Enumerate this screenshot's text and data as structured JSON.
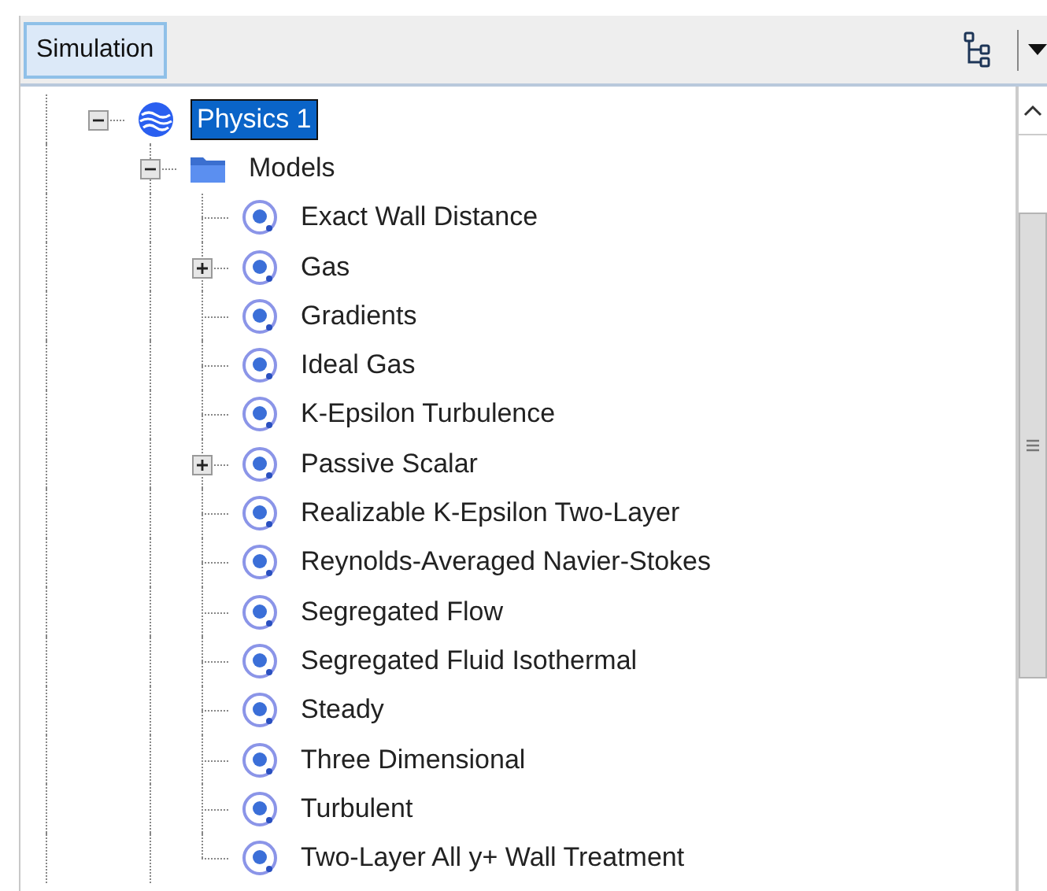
{
  "toolbar": {
    "tab": {
      "label": "Simulation",
      "selected": true
    }
  },
  "tree": [
    {
      "label": "Physics 1",
      "kind": "physics",
      "selected": true,
      "expanded": true,
      "children": [
        {
          "label": "Models",
          "kind": "folder",
          "selected": false,
          "expanded": true,
          "children": [
            {
              "label": "Exact Wall Distance",
              "kind": "model",
              "selected": false
            },
            {
              "label": "Gas",
              "kind": "model",
              "selected": false,
              "expanded": false
            },
            {
              "label": "Gradients",
              "kind": "model",
              "selected": false
            },
            {
              "label": "Ideal Gas",
              "kind": "model",
              "selected": false
            },
            {
              "label": "K-Epsilon Turbulence",
              "kind": "model",
              "selected": false
            },
            {
              "label": "Passive Scalar",
              "kind": "model",
              "selected": false,
              "expanded": false
            },
            {
              "label": "Realizable K-Epsilon Two-Layer",
              "kind": "model",
              "selected": false
            },
            {
              "label": "Reynolds-Averaged Navier-Stokes",
              "kind": "model",
              "selected": false
            },
            {
              "label": "Segregated Flow",
              "kind": "model",
              "selected": false
            },
            {
              "label": "Segregated Fluid Isothermal",
              "kind": "model",
              "selected": false
            },
            {
              "label": "Steady",
              "kind": "model",
              "selected": false
            },
            {
              "label": "Three Dimensional",
              "kind": "model",
              "selected": false
            },
            {
              "label": "Turbulent",
              "kind": "model",
              "selected": false
            },
            {
              "label": "Two-Layer All y+ Wall Treatment",
              "kind": "model",
              "selected": false
            }
          ]
        }
      ]
    }
  ]
}
